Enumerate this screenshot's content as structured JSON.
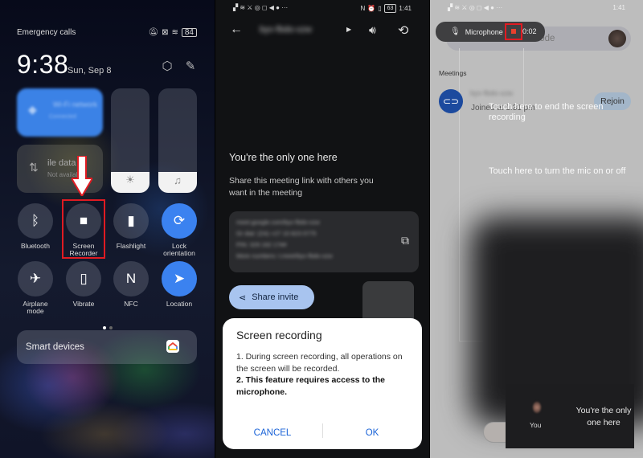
{
  "panel1": {
    "status": {
      "left_text": "Emergency calls",
      "battery": "84"
    },
    "clock": {
      "time": "9:38",
      "date": "Sun, Sep 8"
    },
    "wifi_tile": {
      "name": "Wi-Fi network",
      "status": "Connected"
    },
    "data_tile": {
      "label": "Mobile data",
      "visible_label": "ile data",
      "status": "Not available"
    },
    "sliders": {
      "brightness_level": 0.2,
      "volume_level": 0.2
    },
    "tiles": [
      {
        "label": "Bluetooth",
        "icon": "bluetooth-icon",
        "glyph": "ᛒ",
        "active": false
      },
      {
        "label": "Screen Recorder",
        "icon": "video-camera-icon",
        "glyph": "■",
        "active": false,
        "highlighted": true
      },
      {
        "label": "Flashlight",
        "icon": "flashlight-icon",
        "glyph": "▮",
        "active": false
      },
      {
        "label": "Lock orientation",
        "icon": "rotation-lock-icon",
        "glyph": "⟳",
        "active": true
      },
      {
        "label": "Airplane mode",
        "icon": "airplane-icon",
        "glyph": "✈",
        "active": false
      },
      {
        "label": "Vibrate",
        "icon": "vibrate-icon",
        "glyph": "▯",
        "active": false
      },
      {
        "label": "NFC",
        "icon": "nfc-icon",
        "glyph": "N",
        "active": false
      },
      {
        "label": "Location",
        "icon": "location-arrow-icon",
        "glyph": "➤",
        "active": true
      }
    ],
    "page_indicator": {
      "current": 1,
      "total": 2
    },
    "smart_devices": {
      "label": "Smart devices"
    }
  },
  "panel2": {
    "status": {
      "time": "1:41",
      "battery": "63"
    },
    "header": {
      "meeting_code": "byv-fbdo-xzw"
    },
    "empty_state": {
      "title": "You're the only one here",
      "description": "Share this meeting link with others you want in the meeting"
    },
    "info_card": {
      "lines": [
        "meet.google.com/byv-fbdo-xzw",
        "Or dial: (ZA) +27 10 823 0775",
        "PIN: 329 162 17##",
        "More numbers: t.meet/byv-fbdo-xzw"
      ]
    },
    "share_button": "Share invite",
    "dialog": {
      "title": "Screen recording",
      "point1": "1. During screen recording, all operations on the screen will be recorded.",
      "point2": "2. This feature requires access to the microphone.",
      "cancel": "CANCEL",
      "ok": "OK"
    }
  },
  "panel3": {
    "status": {
      "time": "1:41"
    },
    "search": {
      "placeholder": "Search or enter code"
    },
    "recorder_pill": {
      "mic_label": "Microphone",
      "elapsed": "00:02",
      "visible_elapsed": "0:02"
    },
    "meetings_label": "Meetings",
    "meeting": {
      "name": "byv-fbdo-xzw",
      "joined": "Joined at 1:31 pm",
      "rejoin": "Rejoin"
    },
    "hints": {
      "end_recording": "Touch here to end the screen recording",
      "mic_toggle": "Touch here to turn the mic on or off"
    },
    "self_view": {
      "you_label": "You",
      "message": "You're the only one here"
    }
  },
  "colors": {
    "highlight_red": "#e01b22",
    "tile_active_blue": "#3b82f0",
    "dialog_button_blue": "#1a63d8",
    "share_button_bg": "#a8c4ef",
    "meeting_icon_bg": "#1c4a9e"
  }
}
